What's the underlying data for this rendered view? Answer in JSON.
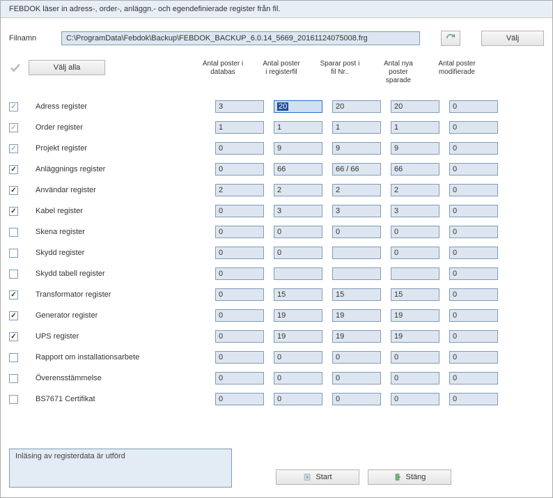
{
  "header": "FEBDOK läser in adress-, order-, anläggn.- och egendefinierade register från fil.",
  "fileRow": {
    "label": "Filnamn",
    "value": "C:\\ProgramData\\Febdok\\Backup\\FEBDOK_BACKUP_6.0.14_5669_20161124075008.frg",
    "chooseBtn": "Välj"
  },
  "selectAll": "Välj alla",
  "columns": {
    "c1a": "Antal poster i",
    "c1b": "databas",
    "c2a": "Antal poster",
    "c2b": "i registerfil",
    "c3a": "Sparar post i",
    "c3b": "fil Nr..",
    "c4a": "Antal nya",
    "c4b": "poster",
    "c4c": "sparade",
    "c5a": "Antal poster",
    "c5b": "modifierade"
  },
  "rows": [
    {
      "checked": true,
      "dim": true,
      "label": "Adress register",
      "v": [
        "3",
        "20",
        "20",
        "20",
        "0"
      ],
      "hi": 1
    },
    {
      "checked": true,
      "dim": true,
      "label": "Order register",
      "v": [
        "1",
        "1",
        "1",
        "1",
        "0"
      ]
    },
    {
      "checked": true,
      "dim": true,
      "label": "Projekt register",
      "v": [
        "0",
        "9",
        "9",
        "9",
        "0"
      ]
    },
    {
      "checked": true,
      "dim": false,
      "label": "Anläggnings register",
      "v": [
        "0",
        "66",
        "66 / 66",
        "66",
        "0"
      ]
    },
    {
      "checked": true,
      "dim": false,
      "label": "Användar register",
      "v": [
        "2",
        "2",
        "2",
        "2",
        "0"
      ]
    },
    {
      "checked": true,
      "dim": false,
      "label": "Kabel register",
      "v": [
        "0",
        "3",
        "3",
        "3",
        "0"
      ]
    },
    {
      "checked": false,
      "dim": false,
      "label": "Skena register",
      "v": [
        "0",
        "0",
        "0",
        "0",
        "0"
      ]
    },
    {
      "checked": false,
      "dim": false,
      "label": "Skydd register",
      "v": [
        "0",
        "0",
        "",
        "0",
        "0"
      ]
    },
    {
      "checked": false,
      "dim": false,
      "label": "Skydd tabell register",
      "v": [
        "0",
        "",
        "",
        "",
        "0"
      ]
    },
    {
      "checked": true,
      "dim": false,
      "label": "Transformator register",
      "v": [
        "0",
        "15",
        "15",
        "15",
        "0"
      ]
    },
    {
      "checked": true,
      "dim": false,
      "label": "Generator register",
      "v": [
        "0",
        "19",
        "19",
        "19",
        "0"
      ]
    },
    {
      "checked": true,
      "dim": false,
      "label": "UPS register",
      "v": [
        "0",
        "19",
        "19",
        "19",
        "0"
      ]
    },
    {
      "checked": false,
      "dim": false,
      "label": "Rapport om installationsarbete",
      "v": [
        "0",
        "0",
        "0",
        "0",
        "0"
      ]
    },
    {
      "checked": false,
      "dim": false,
      "label": "Överensstämmelse",
      "v": [
        "0",
        "0",
        "0",
        "0",
        "0"
      ]
    },
    {
      "checked": false,
      "dim": false,
      "label": "BS7671 Certifikat",
      "v": [
        "0",
        "0",
        "0",
        "0",
        "0"
      ]
    }
  ],
  "status": "Inläsing av registerdata är utförd",
  "footer": {
    "start": "Start",
    "close": "Stäng"
  }
}
